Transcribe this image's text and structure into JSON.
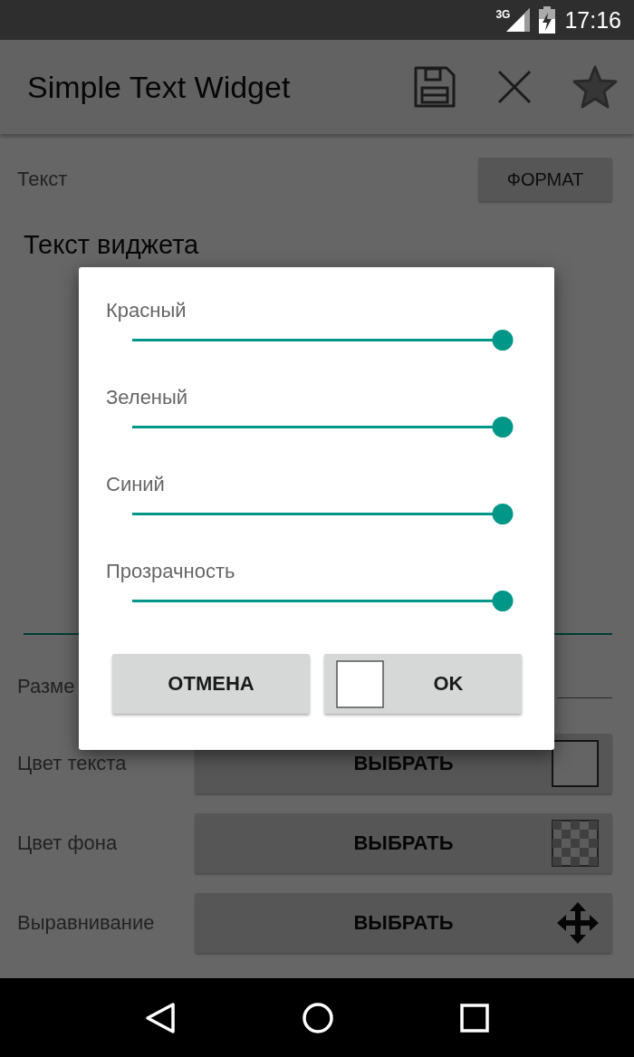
{
  "status_bar": {
    "network": "3G",
    "time": "17:16"
  },
  "toolbar": {
    "title": "Simple Text Widget"
  },
  "form": {
    "text_label": "Текст",
    "format_button": "ФОРМАТ",
    "text_value": "Текст виджета",
    "size_label": "Разме",
    "rows": [
      {
        "label": "Цвет текста",
        "button": "ВЫБРАТЬ",
        "kind": "swatch"
      },
      {
        "label": "Цвет фона",
        "button": "ВЫБРАТЬ",
        "kind": "checker"
      },
      {
        "label": "Выравнивание",
        "button": "ВЫБРАТЬ",
        "kind": "align"
      }
    ]
  },
  "dialog": {
    "sliders": [
      {
        "label": "Красный",
        "level": 1
      },
      {
        "label": "Зеленый",
        "level": 1
      },
      {
        "label": "Синий",
        "level": 1
      },
      {
        "label": "Прозрачность",
        "level": 1
      }
    ],
    "cancel": "ОТМЕНА",
    "ok": "OK"
  }
}
